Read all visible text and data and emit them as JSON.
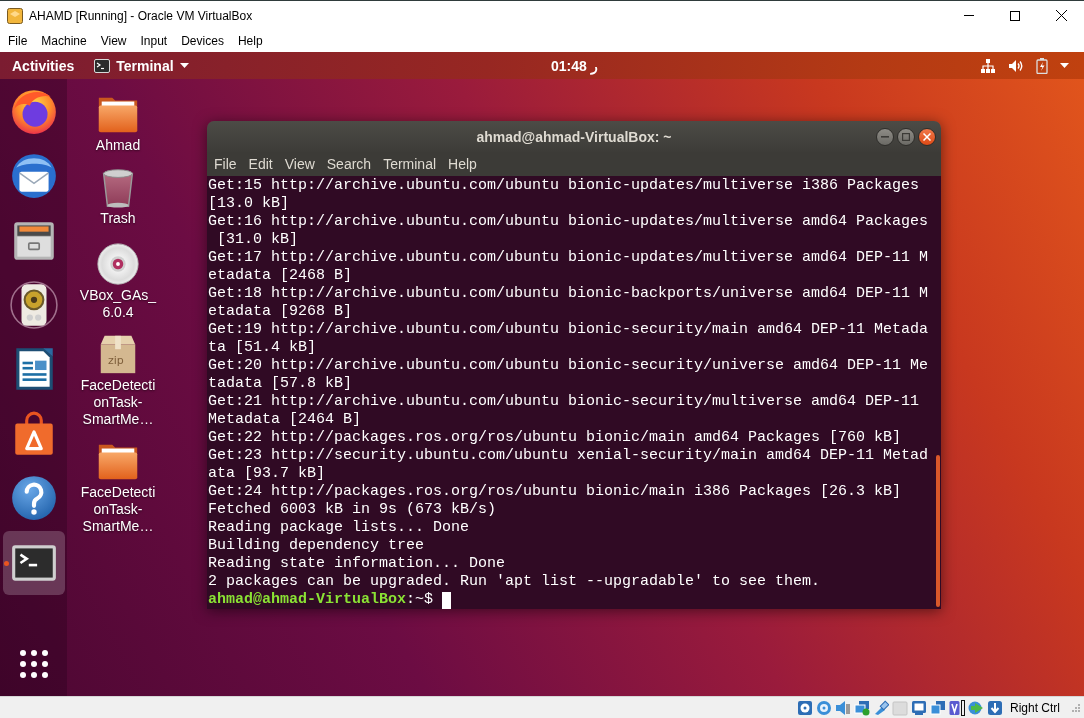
{
  "window": {
    "title": "AHAMD [Running] - Oracle VM VirtualBox"
  },
  "menu": [
    "File",
    "Machine",
    "View",
    "Input",
    "Devices",
    "Help"
  ],
  "top_bar": {
    "activities": "Activities",
    "app_menu": "Terminal",
    "clock": "01:48 ر"
  },
  "dock": {
    "items": [
      {
        "kind": "browser",
        "running": false
      },
      {
        "kind": "mail",
        "running": false
      },
      {
        "kind": "files",
        "running": false
      },
      {
        "kind": "music",
        "running": false
      },
      {
        "kind": "writer",
        "running": false
      },
      {
        "kind": "store",
        "running": false
      },
      {
        "kind": "help",
        "running": false
      },
      {
        "kind": "terminal",
        "running": true
      }
    ]
  },
  "desktop_icons": [
    {
      "kind": "folder",
      "label": "Ahmad"
    },
    {
      "kind": "trash",
      "label": "Trash"
    },
    {
      "kind": "disc",
      "label": "VBox_GAs_\n6.0.4"
    },
    {
      "kind": "archive",
      "label": "FaceDetecti\nonTask-\nSmartMe…",
      "badge": "zip"
    },
    {
      "kind": "folder",
      "label": "FaceDetecti\nonTask-\nSmartMe…"
    }
  ],
  "terminal": {
    "title": "ahmad@ahmad-VirtualBox: ~",
    "menu": [
      "File",
      "Edit",
      "View",
      "Search",
      "Terminal",
      "Help"
    ],
    "lines": [
      "Get:15 http://archive.ubuntu.com/ubuntu bionic-updates/multiverse i386 Packages",
      "[13.0 kB]",
      "Get:16 http://archive.ubuntu.com/ubuntu bionic-updates/multiverse amd64 Packages",
      " [31.0 kB]",
      "Get:17 http://archive.ubuntu.com/ubuntu bionic-updates/multiverse amd64 DEP-11 M",
      "etadata [2468 B]",
      "Get:18 http://archive.ubuntu.com/ubuntu bionic-backports/universe amd64 DEP-11 M",
      "etadata [9268 B]",
      "Get:19 http://archive.ubuntu.com/ubuntu bionic-security/main amd64 DEP-11 Metada",
      "ta [51.4 kB]",
      "Get:20 http://archive.ubuntu.com/ubuntu bionic-security/universe amd64 DEP-11 Me",
      "tadata [57.8 kB]",
      "Get:21 http://archive.ubuntu.com/ubuntu bionic-security/multiverse amd64 DEP-11",
      "Metadata [2464 B]",
      "Get:22 http://packages.ros.org/ros/ubuntu bionic/main amd64 Packages [760 kB]",
      "Get:23 http://security.ubuntu.com/ubuntu xenial-security/main amd64 DEP-11 Metad",
      "ata [93.7 kB]",
      "Get:24 http://packages.ros.org/ros/ubuntu bionic/main i386 Packages [26.3 kB]",
      "Fetched 6003 kB in 9s (673 kB/s)",
      "Reading package lists... Done",
      "Building dependency tree",
      "Reading state information... Done",
      "2 packages can be upgraded. Run 'apt list --upgradable' to see them."
    ],
    "prompt": {
      "user_host": "ahmad@ahmad-VirtualBox",
      "rest": ":~$"
    }
  },
  "status_bar": {
    "host_key": "Right Ctrl"
  }
}
